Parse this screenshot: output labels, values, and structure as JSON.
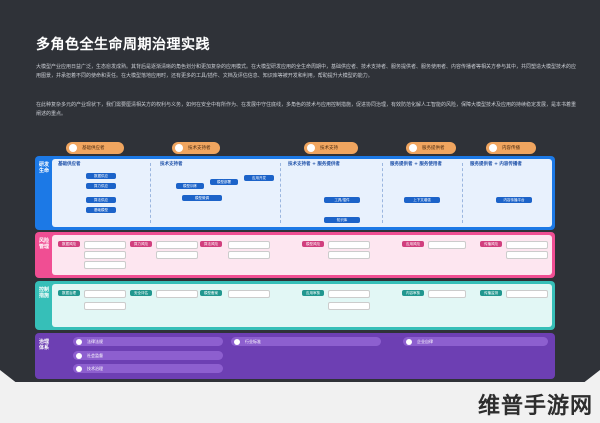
{
  "title": "多角色全生命周期治理实践",
  "intro_paragraph_1": "大模型产业应用日益广泛，生态愈发成熟。其背后是逐渐清晰的角色划分和更加复杂的应用模式。在大模型研发应用的全生命周期中，基础供应者、技术支持者、服务提供者、服务使用者、内容传播者等相关方参与其中，共同塑造大模型技术的应用图景，并承担着不同的使命和责任。在大模型落地应用时，还有更多的工具/插件、文档及评估信息、知识库等被开发和利用，帮助提升大模型的能力。",
  "intro_paragraph_2": "在此种复杂多元的产业现状下，我们需要厘清相关方的权利与义务，如何在安全中有所作为、在发展中守住底线，多角色的技术与应用控制措施，促进协同治理，有效防范化解人工智能的风险，保障大模型技术及应用的持续稳定发展，是本书着重阐述的重点。",
  "phase_tabs": [
    "基础供应者",
    "技术支持者",
    "技术支持",
    "服务提供者",
    "内容传播"
  ],
  "bands": [
    {
      "label": "研发生命",
      "color": "#1c79e6"
    },
    {
      "label": "风险管理",
      "color": "#f04e93"
    },
    {
      "label": "控制措施",
      "color": "#36bfb8"
    },
    {
      "label": "治理体系",
      "color": "#6d3fb3"
    }
  ],
  "column_heads": [
    "基础供应者",
    "技术支持者",
    "技术支持者 + 服务提供者",
    "服务提供者 + 服务使用者",
    "服务提供者 + 内容传播者"
  ],
  "blue_nodes": [
    "数据供应",
    "算力供应",
    "算法供应",
    "基础模型",
    "模型训练",
    "模型部署",
    "模型微调",
    "应用开发",
    "工具/插件",
    "上下文增强",
    "知识库",
    "内容传播平台"
  ],
  "pink_nodes": [
    "数据风险",
    "算力风险",
    "算法风险",
    "模型风险",
    "应用风险",
    "传播风险"
  ],
  "teal_nodes": [
    "数据治理",
    "安全评估",
    "模型备案",
    "应用审核",
    "内容审核",
    "传播监测"
  ],
  "purple_rows": [
    "法律法规",
    "行业标准",
    "企业自律",
    "社会监督",
    "技术治理"
  ],
  "watermark": "维普手游网"
}
